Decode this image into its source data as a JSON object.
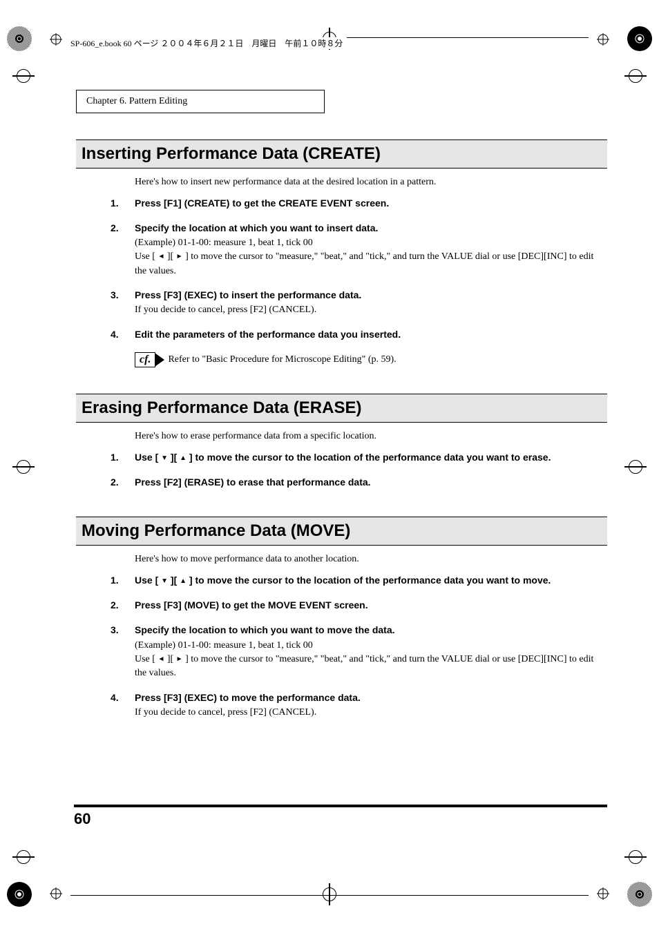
{
  "bookline": "SP-606_e.book  60 ページ  ２００４年６月２１日　月曜日　午前１０時８分",
  "chapter_box": "Chapter 6. Pattern Editing",
  "page_number": "60",
  "icons": {
    "left_arrow": "◄",
    "right_arrow": "►",
    "down_arrow": "▼",
    "up_arrow": "▲"
  },
  "section1": {
    "title": "Inserting Performance Data (CREATE)",
    "intro": "Here's how to insert new performance data at the desired location in a pattern.",
    "steps": [
      {
        "num": "1.",
        "bold": "Press [F1] (CREATE) to get the CREATE EVENT screen."
      },
      {
        "num": "2.",
        "bold": "Specify the location at which you want to insert data.",
        "body_example": "(Example) 01-1-00: measure 1, beat 1, tick 00",
        "body_pre": "Use [ ",
        "body_mid": " ][ ",
        "body_post": " ] to move the cursor to \"measure,\" \"beat,\" and \"tick,\" and turn the VALUE dial or use [DEC][INC] to edit the values."
      },
      {
        "num": "3.",
        "bold": "Press [F3] (EXEC) to insert the performance data.",
        "body": "If you decide to cancel, press [F2] (CANCEL)."
      },
      {
        "num": "4.",
        "bold": "Edit the parameters of the performance data you inserted."
      }
    ],
    "cf_label": "cf.",
    "cf_text": "Refer to \"Basic Procedure for Microscope Editing\" (p. 59)."
  },
  "section2": {
    "title": "Erasing Performance Data (ERASE)",
    "intro": "Here's how to erase performance data from a specific location.",
    "steps": [
      {
        "num": "1.",
        "bold_pre": "Use [ ",
        "bold_mid": " ][ ",
        "bold_post": " ] to move the cursor to the location of the performance data you want to erase."
      },
      {
        "num": "2.",
        "bold": "Press [F2] (ERASE) to erase that performance data."
      }
    ]
  },
  "section3": {
    "title": "Moving Performance Data (MOVE)",
    "intro": "Here's how to move performance data to another location.",
    "steps": [
      {
        "num": "1.",
        "bold_pre": "Use [ ",
        "bold_mid": " ][ ",
        "bold_post": " ] to move the cursor to the location of the performance data you want to move."
      },
      {
        "num": "2.",
        "bold": "Press [F3] (MOVE) to get the MOVE EVENT screen."
      },
      {
        "num": "3.",
        "bold": "Specify the location to which you want to move the data.",
        "body_example": "(Example) 01-1-00: measure 1, beat 1, tick 00",
        "body_pre": "Use [ ",
        "body_mid": " ][ ",
        "body_post": " ] to move the cursor to \"measure,\" \"beat,\" and \"tick,\" and turn the VALUE dial or use [DEC][INC] to edit the values."
      },
      {
        "num": "4.",
        "bold": "Press [F3] (EXEC) to move the performance data.",
        "body": "If you decide to cancel, press [F2] (CANCEL)."
      }
    ]
  }
}
